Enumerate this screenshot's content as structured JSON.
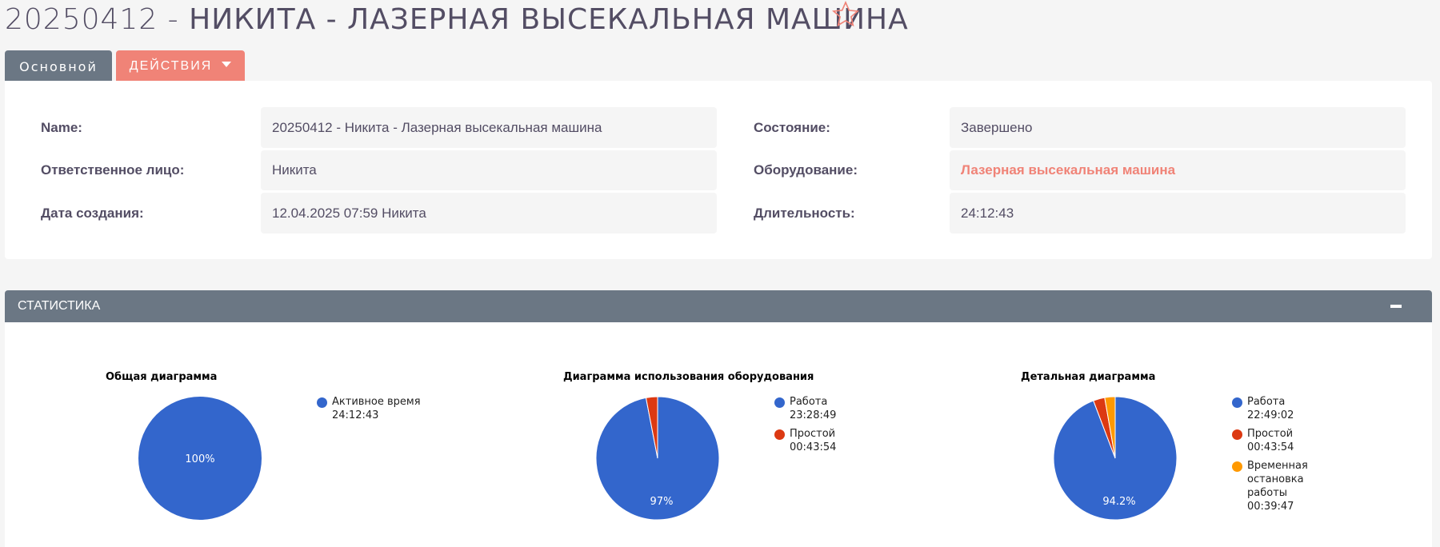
{
  "header": {
    "title_id": "20250412",
    "title_sep": " - ",
    "title_name": "НИКИТА - ЛАЗЕРНАЯ ВЫСЕКАЛЬНАЯ МАШИНА"
  },
  "tabs": {
    "main_label": "Основной",
    "actions_label": "ДЕЙСТВИЯ"
  },
  "details": {
    "name_label": "Name:",
    "name_value": "20250412 - Никита - Лазерная высекальная машина",
    "responsible_label": "Ответственное лицо:",
    "responsible_value": "Никита",
    "created_label": "Дата создания:",
    "created_value": "12.04.2025 07:59 Никита",
    "state_label": "Состояние:",
    "state_value": "Завершено",
    "equipment_label": "Оборудование:",
    "equipment_value": "Лазерная высекальная машина",
    "duration_label": "Длительность:",
    "duration_value": "24:12:43"
  },
  "stats": {
    "header_label": "СТАТИСТИКА"
  },
  "colors": {
    "blue": "#3366cc",
    "red": "#dc3912",
    "orange": "#ff9900",
    "accent": "#f08377",
    "header_gray": "#6b7784"
  },
  "chart_data": [
    {
      "type": "pie",
      "title": "Общая диаграмма",
      "series": [
        {
          "name": "Активное время",
          "value_label": "24:12:43",
          "seconds": 87163,
          "color": "#3366cc"
        }
      ],
      "slice_label": "100%"
    },
    {
      "type": "pie",
      "title": "Диаграмма использования оборудования",
      "series": [
        {
          "name": "Работа",
          "value_label": "23:28:49",
          "seconds": 84529,
          "color": "#3366cc"
        },
        {
          "name": "Простой",
          "value_label": "00:43:54",
          "seconds": 2634,
          "color": "#dc3912"
        }
      ],
      "slice_label": "97%"
    },
    {
      "type": "pie",
      "title": "Детальная диаграмма",
      "series": [
        {
          "name": "Работа",
          "value_label": "22:49:02",
          "seconds": 82142,
          "color": "#3366cc"
        },
        {
          "name": "Простой",
          "value_label": "00:43:54",
          "seconds": 2634,
          "color": "#dc3912"
        },
        {
          "name": "Временная остановка работы",
          "value_label": "00:39:47",
          "seconds": 2387,
          "color": "#ff9900"
        }
      ],
      "slice_label": "94.2%"
    }
  ]
}
